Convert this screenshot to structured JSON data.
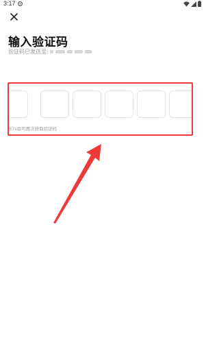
{
  "status_bar": {
    "time": "3:17",
    "icons": [
      "settings-icon",
      "wifi-icon",
      "signal-icon",
      "battery-icon"
    ]
  },
  "header": {
    "close_icon": "close-icon"
  },
  "main": {
    "title": "输入验证码",
    "sent_label": "验证码已发送至:",
    "code_box_count": 6,
    "countdown_text": "57s后可再次获取验证码"
  },
  "annotation": {
    "highlight_color": "#ee3a3a"
  }
}
